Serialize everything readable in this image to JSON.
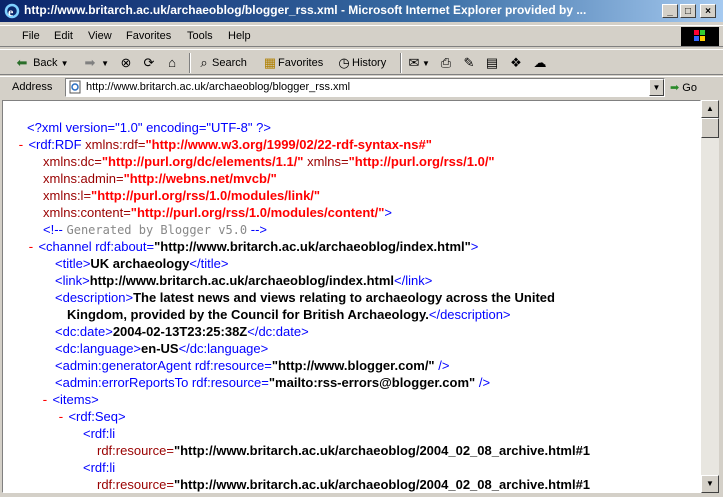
{
  "window": {
    "title": "http://www.britarch.ac.uk/archaeoblog/blogger_rss.xml - Microsoft Internet Explorer provided by ..."
  },
  "menu": [
    "File",
    "Edit",
    "View",
    "Favorites",
    "Tools",
    "Help"
  ],
  "toolbar": {
    "back": "Back",
    "search": "Search",
    "favorites": "Favorites",
    "history": "History"
  },
  "address": {
    "label": "Address",
    "url": "http://www.britarch.ac.uk/archaeoblog/blogger_rss.xml",
    "go": "Go"
  },
  "xml": {
    "decl": "<?xml version=\"1.0\" encoding=\"UTF-8\" ?>",
    "minus": "-",
    "rdf_open": "<rdf:RDF",
    "a_xmlns_rdf": "xmlns:rdf=",
    "v_xmlns_rdf": "\"http://www.w3.org/1999/02/22-rdf-syntax-ns#\"",
    "a_xmlns_dc": "xmlns:dc=",
    "v_xmlns_dc": "\"http://purl.org/dc/elements/1.1/\"",
    "a_xmlns": "xmlns=",
    "v_xmlns": "\"http://purl.org/rss/1.0/\"",
    "a_xmlns_admin": "xmlns:admin=",
    "v_xmlns_admin": "\"http://webns.net/mvcb/\"",
    "a_xmlns_l": "xmlns:l=",
    "v_xmlns_l": "\"http://purl.org/rss/1.0/modules/link/\"",
    "a_xmlns_content": "xmlns:content=",
    "v_xmlns_content": "\"http://purl.org/rss/1.0/modules/content/\"",
    "close_gt": ">",
    "c_open": "<!--",
    "comment": "Generated by Blogger v5.0",
    "c_close": "-->",
    "channel_open": "<channel rdf:about=",
    "channel_about": "\"http://www.britarch.ac.uk/archaeoblog/index.html\"",
    "title_open": "<title>",
    "title_text": "UK archaeology",
    "title_close": "</title>",
    "link_open": "<link>",
    "link_text": "http://www.britarch.ac.uk/archaeoblog/index.html",
    "link_close": "</link>",
    "desc_open": "<description>",
    "desc_text_1": "The latest news and views relating to archaeology across the United",
    "desc_text_2": "Kingdom, provided by the Council for British Archaeology.",
    "desc_close": "</description>",
    "date_open": "<dc:date>",
    "date_text": "2004-02-13T23:25:38Z",
    "date_close": "</dc:date>",
    "lang_open": "<dc:language>",
    "lang_text": "en-US",
    "lang_close": "</dc:language>",
    "gen_open": "<admin:generatorAgent rdf:resource=",
    "gen_val": "\"http://www.blogger.com/\"",
    "selfclose": "/>",
    "err_open": "<admin:errorReportsTo rdf:resource=",
    "err_val": "\"mailto:rss-errors@blogger.com\"",
    "items_open": "<items>",
    "seq_open": "<rdf:Seq>",
    "li_open": "<rdf:li",
    "li_attr": "rdf:resource=",
    "li_val": "\"http://www.britarch.ac.uk/archaeoblog/2004_02_08_archive.html#1",
    "li_open_2": "<rdf:li",
    "li_attr_2": "rdf:resource=",
    "li_val_2": "\"http://www.britarch.ac.uk/archaeoblog/2004_02_08_archive.html#1"
  }
}
